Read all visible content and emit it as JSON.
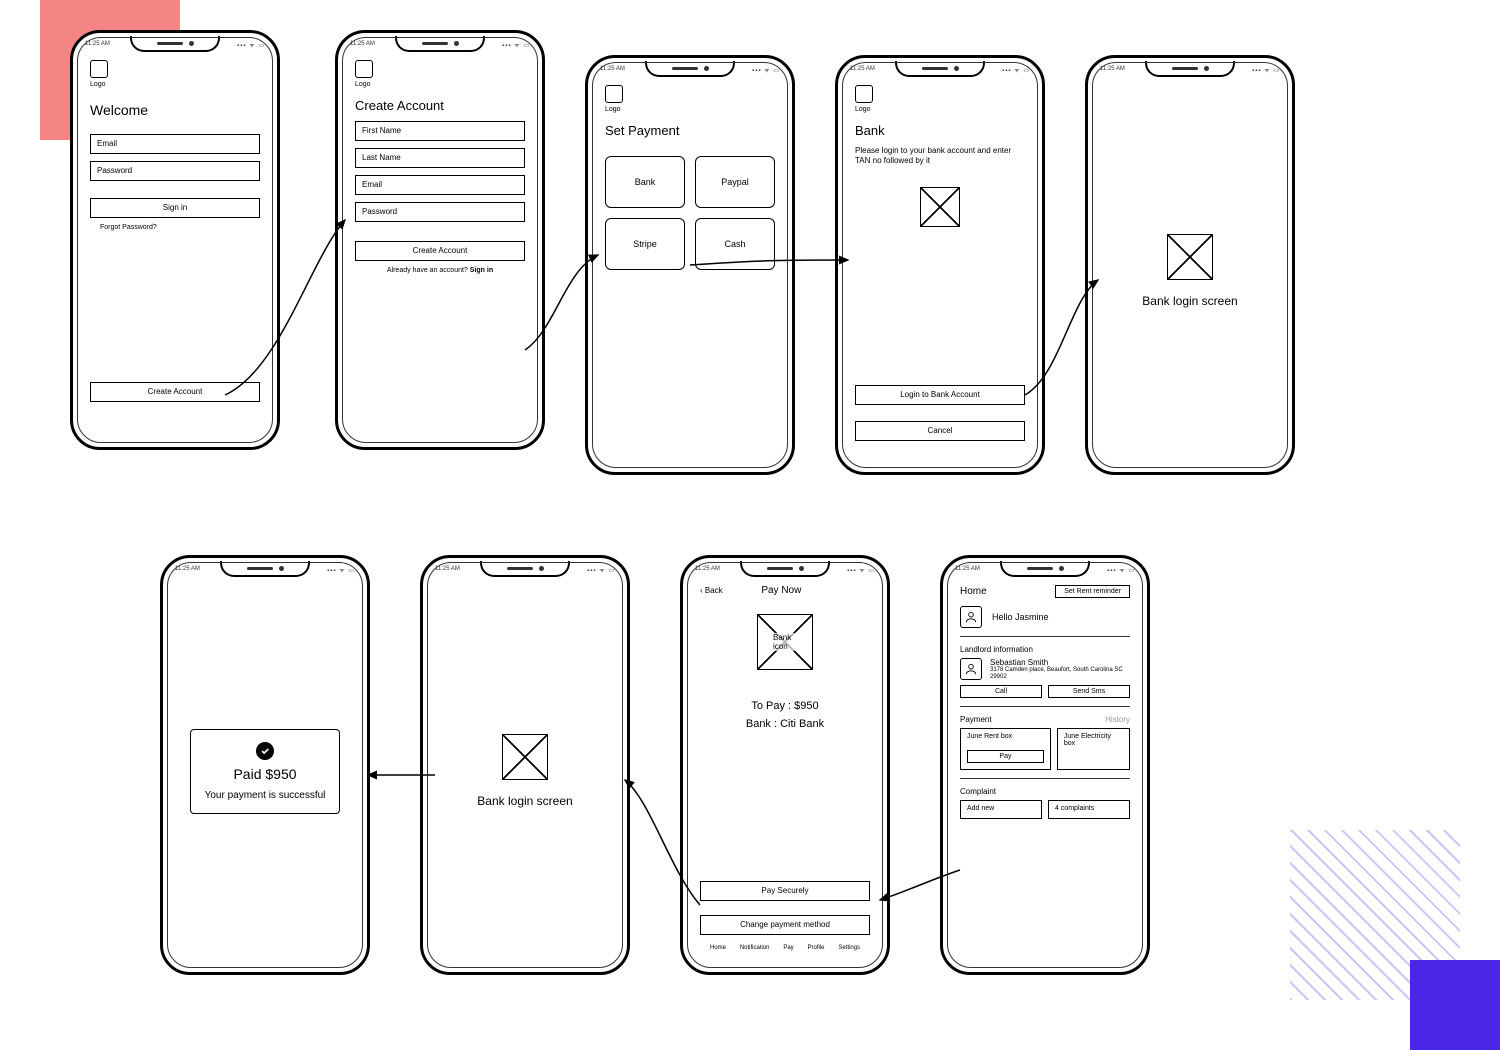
{
  "status": {
    "time": "11:25 AM",
    "signal": "▪▪▪ ᯤ ▭"
  },
  "logo_label": "Logo",
  "screens": {
    "welcome": {
      "title": "Welcome",
      "email_ph": "Email",
      "password_ph": "Password",
      "signin_label": "Sign in",
      "forgot_label": "Forgot Password?",
      "create_label": "Create Account"
    },
    "create": {
      "title": "Create Account",
      "first_ph": "First Name",
      "last_ph": "Last Name",
      "email_ph": "Email",
      "password_ph": "Password",
      "create_label": "Create Account",
      "already_text": "Already have an account?",
      "signin_label": "Sign in"
    },
    "payment": {
      "title": "Set Payment",
      "options": [
        "Bank",
        "Paypal",
        "Stripe",
        "Cash"
      ]
    },
    "bank": {
      "title": "Bank",
      "sub": "Please login to your bank account and enter TAN no followed by it",
      "login_label": "Login to Bank Account",
      "cancel_label": "Cancel"
    },
    "banklogin": {
      "title": "Bank login screen"
    },
    "paid": {
      "amount_label": "Paid $950",
      "msg": "Your payment is successful"
    },
    "paynow": {
      "back": "Back",
      "title": "Pay Now",
      "icon_label": "Bank icon",
      "topay": "To Pay : $950",
      "bank": "Bank : Citi Bank",
      "pay_label": "Pay Securely",
      "change_label": "Change payment method",
      "nav": [
        "Home",
        "Notification",
        "Pay",
        "Profile",
        "Settings"
      ]
    },
    "home": {
      "title": "Home",
      "reminder_btn": "Set Rent reminder",
      "greeting": "Hello Jasmine",
      "landlord_section": "Landlord information",
      "landlord_name": "Sebastian Smith",
      "landlord_addr": "3178 Camden place, Beaufort, South Carolina SC 29902",
      "call_label": "Call",
      "sms_label": "Send Sms",
      "payment_section": "Payment",
      "history_label": "History",
      "rent_box": "June Rent box",
      "pay_btn": "Pay",
      "elec_box": "June Electricity box",
      "complaint_section": "Complaint",
      "addnew": "Add new",
      "complaints_count": "4 complaints"
    }
  }
}
